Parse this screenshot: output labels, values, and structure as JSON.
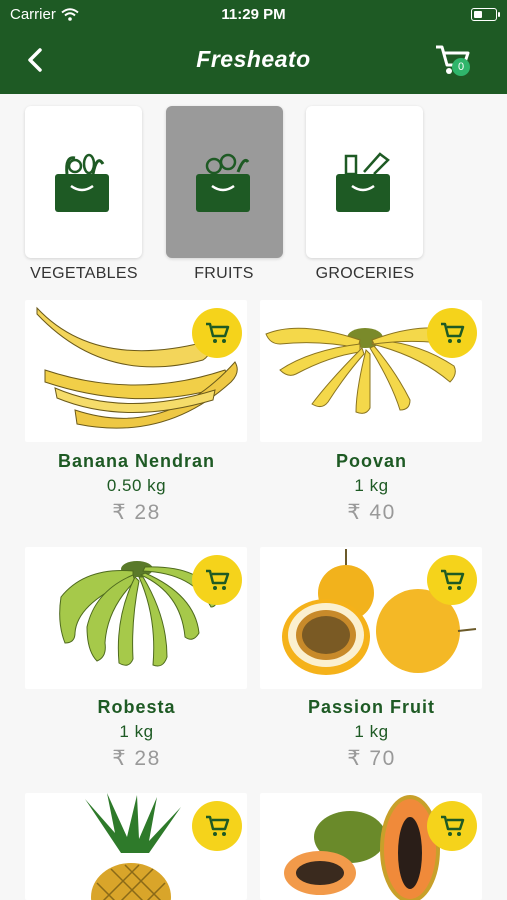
{
  "status_bar": {
    "carrier": "Carrier",
    "time": "11:29 PM"
  },
  "header": {
    "title": "Fresheato",
    "cart_count": "0"
  },
  "categories": [
    {
      "label": "VEGETABLES"
    },
    {
      "label": "FRUITS"
    },
    {
      "label": "GROCERIES"
    }
  ],
  "products": [
    {
      "name": "Banana Nendran",
      "qty": "0.50 kg",
      "price": "₹ 28"
    },
    {
      "name": "Poovan",
      "qty": "1 kg",
      "price": "₹ 40"
    },
    {
      "name": "Robesta",
      "qty": "1 kg",
      "price": "₹ 28"
    },
    {
      "name": "Passion Fruit",
      "qty": "1 kg",
      "price": "₹ 70"
    }
  ],
  "colors": {
    "header": "#1e5a24",
    "accent_yellow": "#f5d31b",
    "badge": "#2fb56b"
  }
}
